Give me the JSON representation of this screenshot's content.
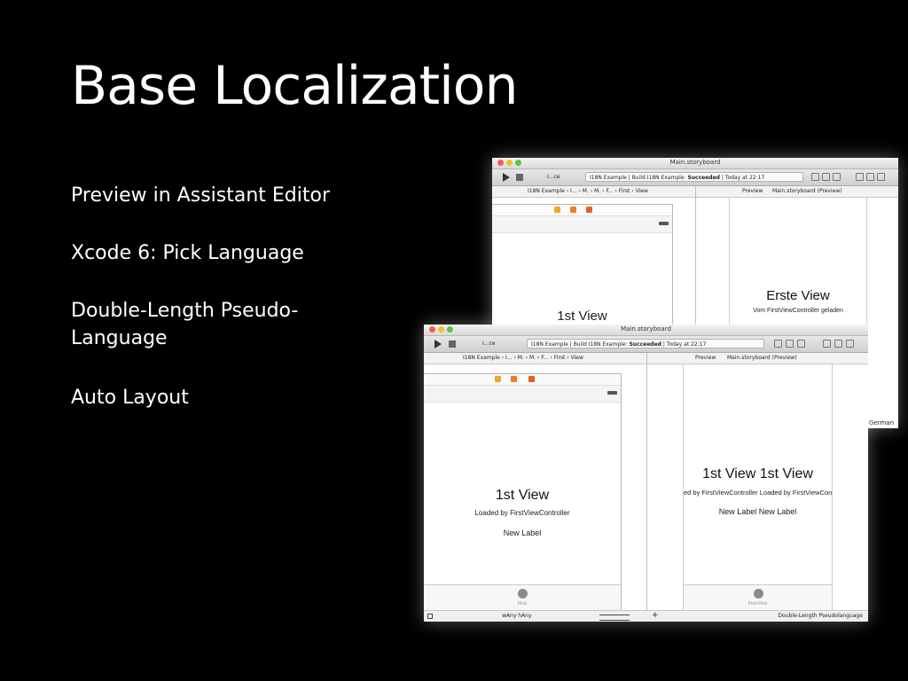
{
  "slide": {
    "title": "Base Localization",
    "bullets": [
      "Preview in Assistant Editor",
      "Xcode 6: Pick Language",
      "Double-Length Pseudo-Language",
      "Auto Layout"
    ]
  },
  "windows": [
    {
      "title": "Main.storyboard",
      "scheme": "I...ce",
      "status_scheme": "I18N Example",
      "status_build": "Build I18N Example:",
      "status_result": "Succeeded",
      "status_time": "Today at 22:17",
      "jump_left": "I18N Example  ›  I...  ›  M.  ›  M.  ›  F...  ›  First  ›  View",
      "jump_right_preview": "Preview",
      "jump_right_file": "Main.storyboard (Preview)",
      "left_title": "1st View",
      "right_title": "Erste View",
      "right_subtitle": "Vom FirstViewController geladen",
      "language": "German"
    },
    {
      "title": "Main.storyboard",
      "scheme": "I...ce",
      "status_scheme": "I18N Example",
      "status_build": "Build I18N Example:",
      "status_result": "Succeeded",
      "status_time": "Today at 22:17",
      "jump_left": "I18N Example  ›  I...  ›  M.  ›  M.  ›  F...  ›  First  ›  View",
      "jump_right_preview": "Preview",
      "jump_right_file": "Main.storyboard (Preview)",
      "left_title": "1st View",
      "left_subtitle": "Loaded by FirstViewController",
      "left_label": "New Label",
      "left_tab": "First",
      "size_class": "wAny  hAny",
      "right_title": "1st View 1st View",
      "right_subtitle": "ed by FirstViewController Loaded by FirstViewCon",
      "right_label": "New Label New Label",
      "right_tab": "First First",
      "language": "Double-Length Pseudolanguage"
    }
  ],
  "colors": {
    "background": "#000000",
    "text": "#ffffff",
    "close": "#f45b4f",
    "minimize": "#f6be2f",
    "zoom": "#59c53d"
  }
}
